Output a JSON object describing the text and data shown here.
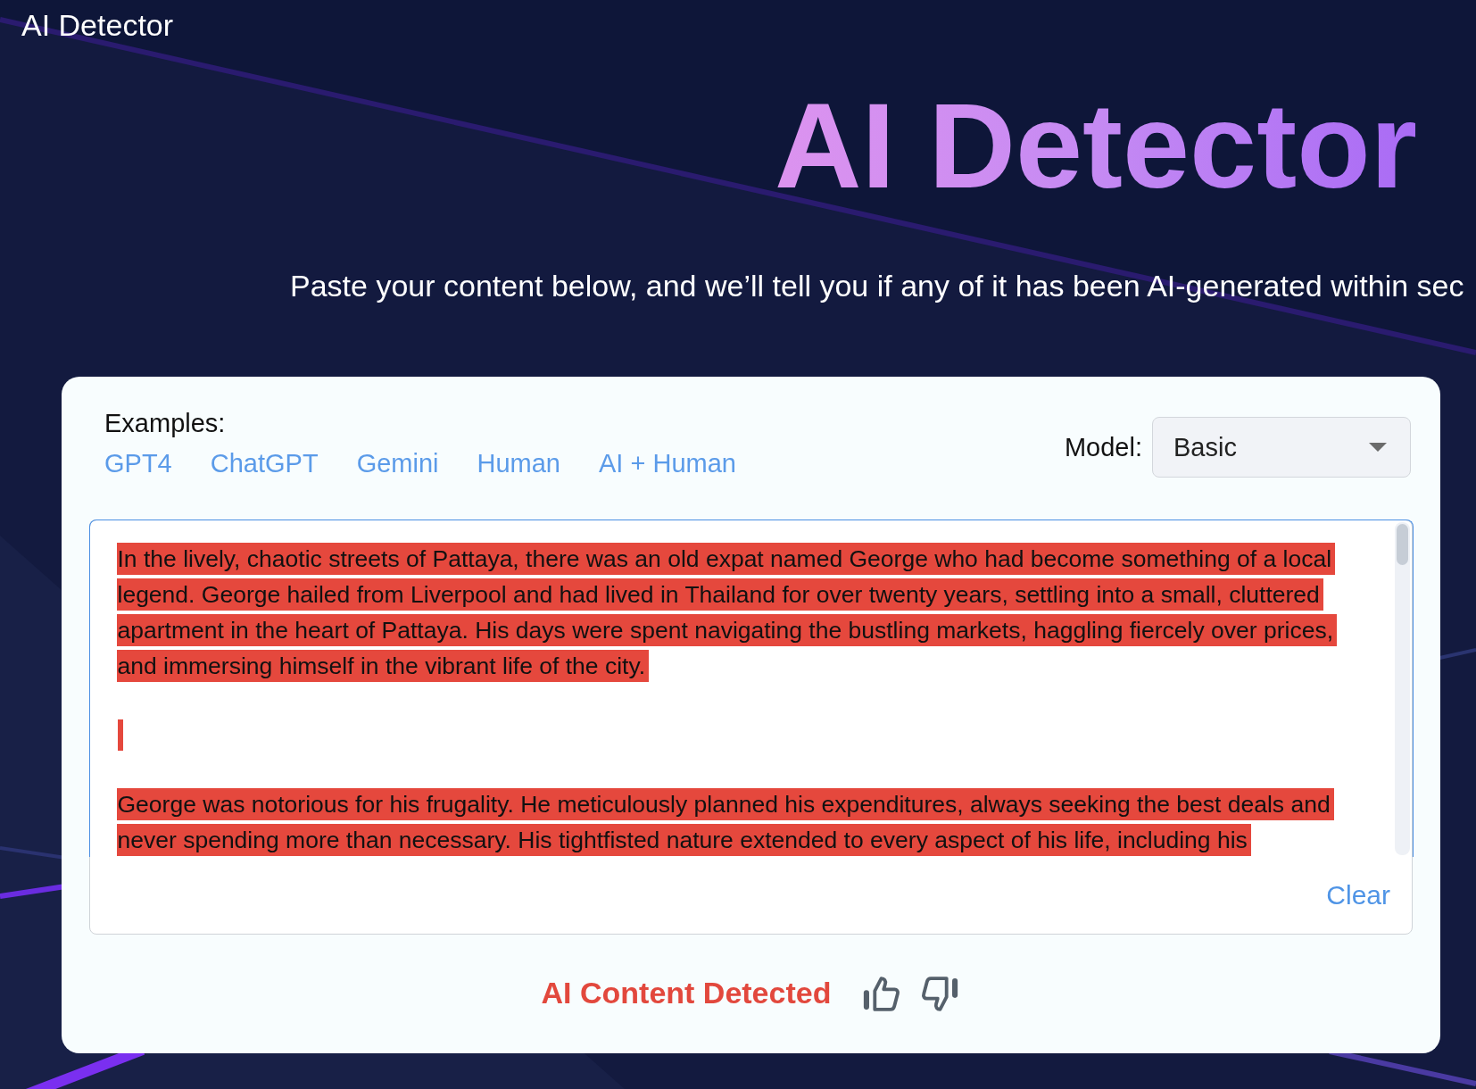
{
  "header": {
    "title": "AI Detector"
  },
  "hero": {
    "heading": "AI Detector",
    "subtitle": "Paste your content below, and we’ll tell you if any of it has been AI-generated within sec"
  },
  "examples": {
    "label": "Examples:",
    "links": [
      "GPT4",
      "ChatGPT",
      "Gemini",
      "Human",
      "AI + Human"
    ]
  },
  "model": {
    "label": "Model:",
    "value": "Basic"
  },
  "editor": {
    "paragraphs": [
      {
        "kind": "text",
        "highlighted": true,
        "lines": [
          "In the lively, chaotic streets of Pattaya, there was an old expat named George who had become something of a local",
          "legend. George hailed from Liverpool and had lived in Thailand for over twenty years, settling into a small, cluttered",
          "apartment in the heart of Pattaya. His days were spent navigating the bustling markets, haggling fiercely over prices,",
          "and immersing himself in the vibrant life of the city."
        ]
      },
      {
        "kind": "blank",
        "highlighted": true
      },
      {
        "kind": "text",
        "highlighted": true,
        "lines": [
          "George was notorious for his frugality. He meticulously planned his expenditures, always seeking the best deals and",
          "never spending more than necessary. His tightfisted nature extended to every aspect of his life, including his"
        ]
      }
    ],
    "clear": "Clear"
  },
  "result": {
    "ai_detected": true,
    "label": "AI Content Detected"
  }
}
